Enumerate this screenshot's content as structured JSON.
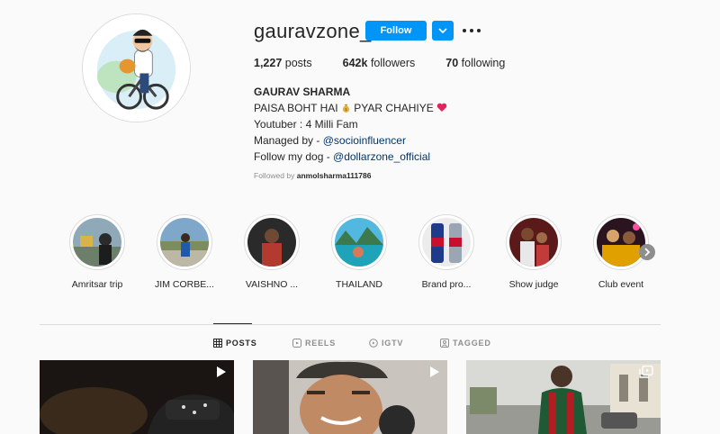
{
  "profile": {
    "username": "gauravzone_",
    "follow_label": "Follow",
    "posts_count": "1,227",
    "posts_label": "posts",
    "followers_count": "642k",
    "followers_label": "followers",
    "following_count": "70",
    "following_label": "following"
  },
  "bio": {
    "name": "GAURAV SHARMA",
    "line1_a": "PAISA BOHT HAI",
    "line1_b": "PYAR CHAHIYE",
    "line2": "Youtuber : 4 Milli Fam",
    "line3_prefix": "Managed by - ",
    "line3_mention": "@socioinfluencer",
    "line4_prefix": "Follow my dog - ",
    "line4_mention": "@dollarzone_official",
    "followed_by_prefix": "Followed by",
    "followed_by_user": "anmolsharma111786"
  },
  "highlights": [
    {
      "label": "Amritsar trip"
    },
    {
      "label": "JIM CORBE..."
    },
    {
      "label": "VAISHNO ..."
    },
    {
      "label": "THAILAND"
    },
    {
      "label": "Brand pro..."
    },
    {
      "label": "Show judge"
    },
    {
      "label": "Club event"
    }
  ],
  "tabs": [
    {
      "label": "POSTS",
      "active": true
    },
    {
      "label": "REELS",
      "active": false
    },
    {
      "label": "IGTV",
      "active": false
    },
    {
      "label": "TAGGED",
      "active": false
    }
  ],
  "posts": [
    {
      "badge": "reel-icon"
    },
    {
      "badge": "reel-icon"
    },
    {
      "badge": "carousel-icon"
    }
  ],
  "colors": {
    "accent": "#0095f6",
    "text": "#262626",
    "muted": "#8e8e8e",
    "link": "#00376b",
    "background": "#fafafa"
  }
}
